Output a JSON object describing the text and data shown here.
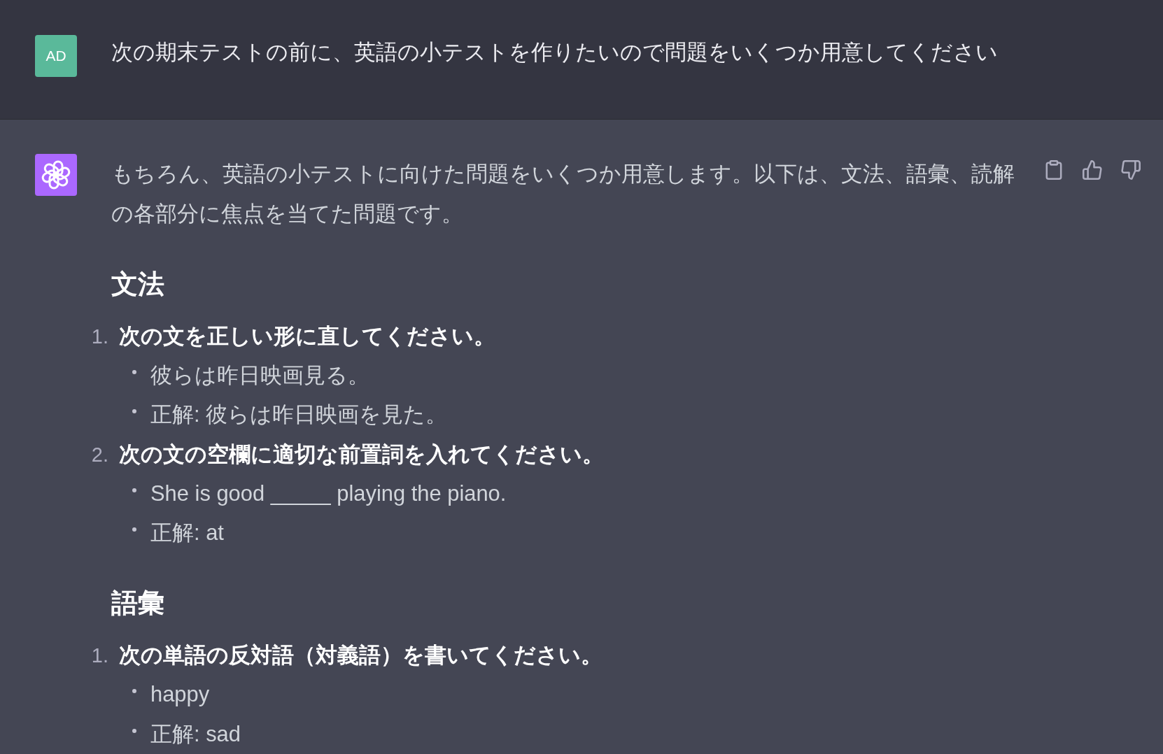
{
  "conversation": [
    {
      "kind": "user",
      "avatar": "AD",
      "text": "次の期末テストの前に、英語の小テストを作りたいので問題をいくつか用意してください"
    },
    {
      "kind": "assistant",
      "text": "もちろん、英語の小テストに向けた問題をいくつか用意します。以下は、文法、語彙、読解の各部分に焦点を当てた問題です。",
      "sections": [
        {
          "heading": "文法",
          "items": [
            {
              "number": "1.",
              "text": "次の文を正しい形に直してください。",
              "bullets": [
                "彼らは昨日映画見る。",
                "正解: 彼らは昨日映画を見た。"
              ]
            },
            {
              "number": "2.",
              "text": "次の文の空欄に適切な前置詞を入れてください。",
              "bullets": [
                "She is good _____ playing the piano.",
                "正解: at"
              ]
            }
          ]
        },
        {
          "heading": "語彙",
          "items": [
            {
              "number": "1.",
              "text": "次の単語の反対語（対義語）を書いてください。",
              "bullets": [
                "happy",
                "正解: sad"
              ]
            }
          ]
        }
      ]
    }
  ]
}
